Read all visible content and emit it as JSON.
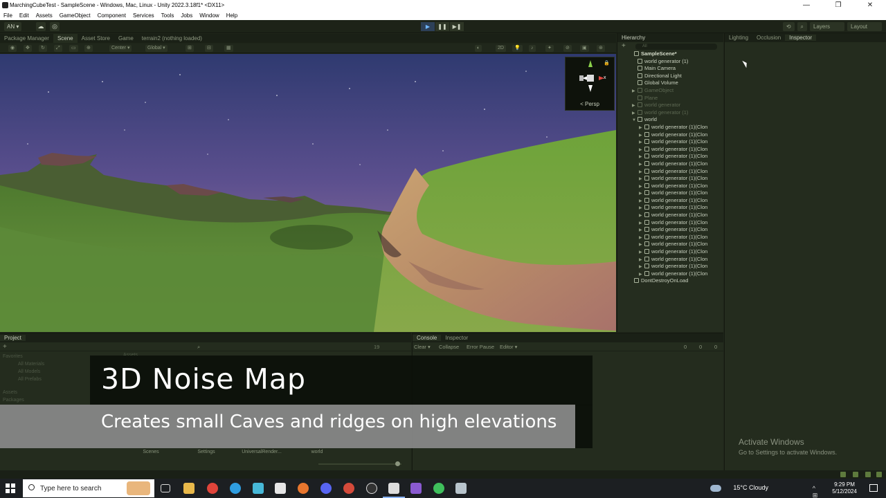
{
  "window": {
    "title": "MarchingCubeTest - SampleScene - Windows, Mac, Linux - Unity 2022.3.18f1* <DX11>",
    "controls": [
      "—",
      "❐",
      "✕"
    ]
  },
  "menu": [
    "File",
    "Edit",
    "Assets",
    "GameObject",
    "Component",
    "Services",
    "Tools",
    "Jobs",
    "Window",
    "Help"
  ],
  "toolbar": {
    "account": "AN ▾",
    "layers": "Layers",
    "layout": "Layout",
    "play_icon": "▶",
    "pause_icon": "❚❚",
    "step_icon": "▶❚"
  },
  "scene_tabs": [
    "Package Manager",
    "Scene",
    "Asset Store",
    "Game",
    "terrain2 (nothing loaded)"
  ],
  "scene_toolbar": {
    "pivot": "Center ▾",
    "space": "Global ▾",
    "mode_2d": "2D"
  },
  "gizmo": {
    "x_label": "x",
    "projection": "< Persp"
  },
  "hierarchy": {
    "tab": "Hierarchy",
    "add": "+",
    "search_placeholder": "All",
    "scene": "SampleScene*",
    "items": [
      {
        "label": "world generator (1)",
        "depth": 1,
        "dim": false,
        "arrow": ""
      },
      {
        "label": "Main Camera",
        "depth": 1,
        "dim": false,
        "arrow": ""
      },
      {
        "label": "Directional Light",
        "depth": 1,
        "dim": false,
        "arrow": ""
      },
      {
        "label": "Global Volume",
        "depth": 1,
        "dim": false,
        "arrow": ""
      },
      {
        "label": "GameObject",
        "depth": 1,
        "dim": true,
        "arrow": "▶"
      },
      {
        "label": "Plane",
        "depth": 1,
        "dim": true,
        "arrow": ""
      },
      {
        "label": "world generator",
        "depth": 1,
        "dim": true,
        "arrow": "▶"
      },
      {
        "label": "world generator (1)",
        "depth": 1,
        "dim": true,
        "arrow": "▶"
      },
      {
        "label": "world",
        "depth": 1,
        "dim": false,
        "arrow": "▼"
      },
      {
        "label": "world generator (1)(Clon",
        "depth": 2,
        "dim": false,
        "arrow": "▶"
      },
      {
        "label": "world generator (1)(Clon",
        "depth": 2,
        "dim": false,
        "arrow": "▶"
      },
      {
        "label": "world generator (1)(Clon",
        "depth": 2,
        "dim": false,
        "arrow": "▶"
      },
      {
        "label": "world generator (1)(Clon",
        "depth": 2,
        "dim": false,
        "arrow": "▶"
      },
      {
        "label": "world generator (1)(Clon",
        "depth": 2,
        "dim": false,
        "arrow": "▶"
      },
      {
        "label": "world generator (1)(Clon",
        "depth": 2,
        "dim": false,
        "arrow": "▶"
      },
      {
        "label": "world generator (1)(Clon",
        "depth": 2,
        "dim": false,
        "arrow": "▶"
      },
      {
        "label": "world generator (1)(Clon",
        "depth": 2,
        "dim": false,
        "arrow": "▶"
      },
      {
        "label": "world generator (1)(Clon",
        "depth": 2,
        "dim": false,
        "arrow": "▶"
      },
      {
        "label": "world generator (1)(Clon",
        "depth": 2,
        "dim": false,
        "arrow": "▶"
      },
      {
        "label": "world generator (1)(Clon",
        "depth": 2,
        "dim": false,
        "arrow": "▶"
      },
      {
        "label": "world generator (1)(Clon",
        "depth": 2,
        "dim": false,
        "arrow": "▶"
      },
      {
        "label": "world generator (1)(Clon",
        "depth": 2,
        "dim": false,
        "arrow": "▶"
      },
      {
        "label": "world generator (1)(Clon",
        "depth": 2,
        "dim": false,
        "arrow": "▶"
      },
      {
        "label": "world generator (1)(Clon",
        "depth": 2,
        "dim": false,
        "arrow": "▶"
      },
      {
        "label": "world generator (1)(Clon",
        "depth": 2,
        "dim": false,
        "arrow": "▶"
      },
      {
        "label": "world generator (1)(Clon",
        "depth": 2,
        "dim": false,
        "arrow": "▶"
      },
      {
        "label": "world generator (1)(Clon",
        "depth": 2,
        "dim": false,
        "arrow": "▶"
      },
      {
        "label": "world generator (1)(Clon",
        "depth": 2,
        "dim": false,
        "arrow": "▶"
      },
      {
        "label": "world generator (1)(Clon",
        "depth": 2,
        "dim": false,
        "arrow": "▶"
      },
      {
        "label": "world generator (1)(Clon",
        "depth": 2,
        "dim": false,
        "arrow": "▶"
      }
    ],
    "footer_scene": "DontDestroyOnLoad"
  },
  "inspector_tabs": [
    "Lighting",
    "Occlusion",
    "Inspector"
  ],
  "activate": {
    "title": "Activate Windows",
    "subtitle": "Go to Settings to activate Windows."
  },
  "project": {
    "tab": "Project",
    "add": "+",
    "count": "19",
    "tree": [
      "Favorites",
      "All Materials",
      "All Models",
      "All Prefabs",
      "Assets",
      "Packages"
    ],
    "breadcrumb": "Assets",
    "folders": [
      "Scenes",
      "Settings",
      "UniversalRender...",
      "world"
    ]
  },
  "console": {
    "tabs": [
      "Console",
      "Inspector"
    ],
    "clear": "Clear ▾",
    "collapse": "Collapse",
    "error_pause": "Error Pause",
    "editor": "Editor ▾",
    "counts": [
      "0",
      "0",
      "0"
    ]
  },
  "caption": {
    "heading": "3D Noise Map",
    "subheading": "Creates small Caves and ridges on high elevations"
  },
  "taskbar": {
    "search_placeholder": "Type here to search",
    "weather": "15°C  Cloudy",
    "time": "9:29 PM",
    "date": "5/12/2024",
    "tray_icons": "^ ⊞ 🎤 ◻ 🔊"
  }
}
